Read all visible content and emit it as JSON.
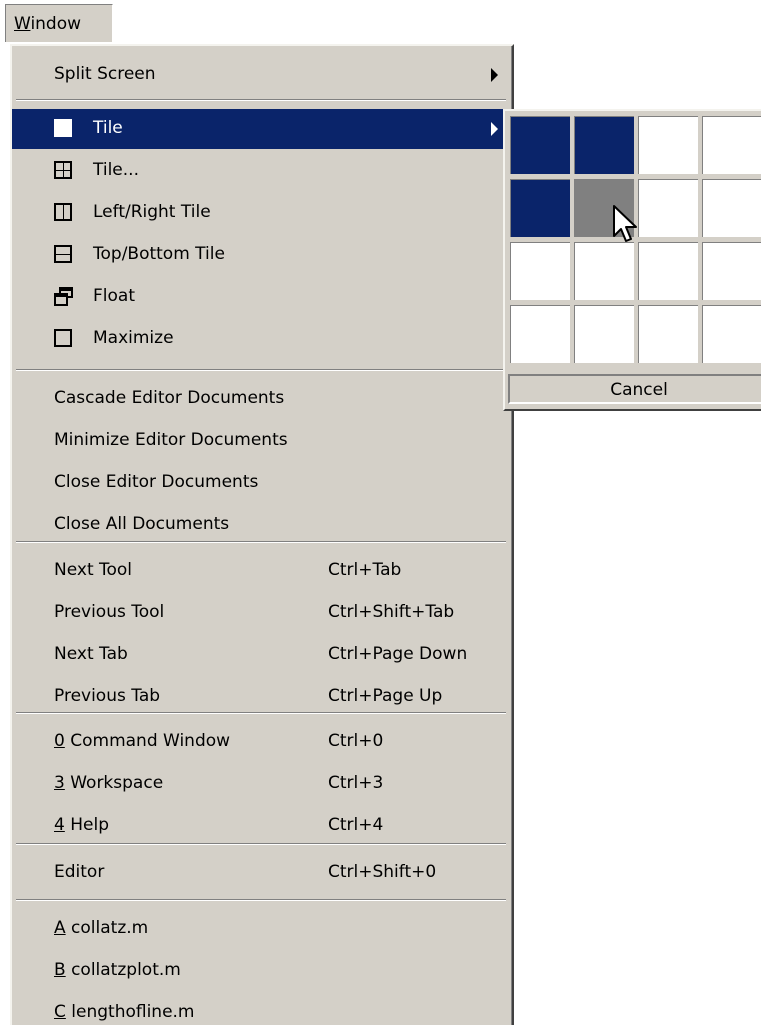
{
  "menubar": {
    "window_label_mnemonic": "W",
    "window_label_rest": "indow"
  },
  "menu": {
    "split_screen": "Split Screen",
    "tile": "Tile",
    "tile_dialog": "Tile...",
    "left_right_tile": "Left/Right Tile",
    "top_bottom_tile": "Top/Bottom Tile",
    "float": "Float",
    "maximize": "Maximize",
    "cascade": "Cascade Editor Documents",
    "minimize": "Minimize Editor Documents",
    "close_editor": "Close Editor Documents",
    "close_all": "Close All Documents",
    "next_tool": {
      "label": "Next Tool",
      "shortcut": "Ctrl+Tab"
    },
    "previous_tool": {
      "label": "Previous Tool",
      "shortcut": "Ctrl+Shift+Tab"
    },
    "next_tab": {
      "label": "Next Tab",
      "shortcut": "Ctrl+Page Down"
    },
    "previous_tab": {
      "label": "Previous Tab",
      "shortcut": "Ctrl+Page Up"
    },
    "command_window": {
      "mnemonic": "0",
      "label": " Command Window",
      "shortcut": "Ctrl+0"
    },
    "workspace": {
      "mnemonic": "3",
      "label": " Workspace",
      "shortcut": "Ctrl+3"
    },
    "help": {
      "mnemonic": "4",
      "label": " Help",
      "shortcut": "Ctrl+4"
    },
    "editor": {
      "label": "Editor",
      "shortcut": "Ctrl+Shift+0"
    },
    "doc_a": {
      "mnemonic": "A",
      "label": " collatz.m"
    },
    "doc_b": {
      "mnemonic": "B",
      "label": " collatzplot.m"
    },
    "doc_c": {
      "mnemonic": "C",
      "label": " lengthofline.m"
    }
  },
  "tile_grid": {
    "rows": 4,
    "columns": 4,
    "selected_cells": [
      "r1c1",
      "r1c2",
      "r2c1"
    ],
    "hover_cell": "r2c2",
    "cancel_label": "Cancel"
  },
  "colors": {
    "menu_bg": "#d4d0c8",
    "highlight": "#0a246a",
    "hover_cell": "#808080"
  }
}
